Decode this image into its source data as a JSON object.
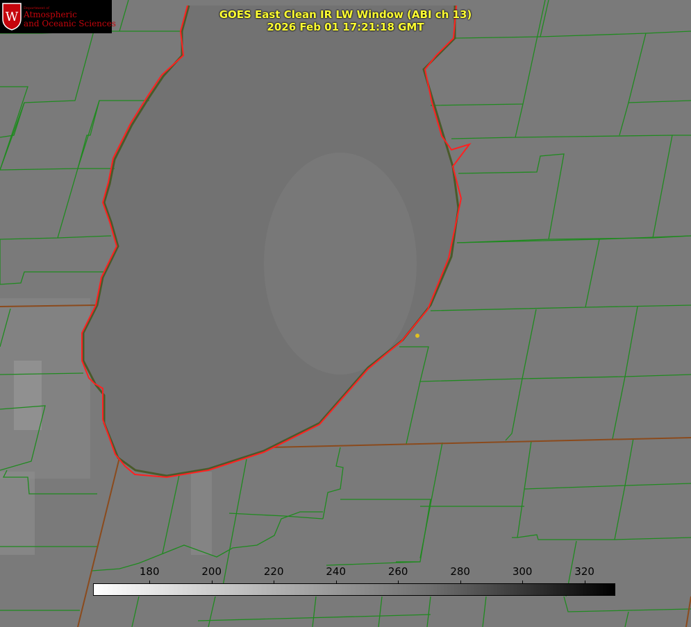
{
  "logo": {
    "department": "Department of",
    "line1": "Atmospheric",
    "line2": "and Oceanic Sciences",
    "crest_letter": "W",
    "brand_color": "#c5050c"
  },
  "title": {
    "line1": "GOES East Clean IR LW Window (ABI ch 13)",
    "line2": "2026 Feb 01 17:21:18 GMT",
    "color": "#ffff33"
  },
  "colorbar": {
    "ticks": [
      {
        "value": "180",
        "pos": 0.108
      },
      {
        "value": "200",
        "pos": 0.227
      },
      {
        "value": "220",
        "pos": 0.346
      },
      {
        "value": "240",
        "pos": 0.465
      },
      {
        "value": "260",
        "pos": 0.584
      },
      {
        "value": "280",
        "pos": 0.703
      },
      {
        "value": "300",
        "pos": 0.822
      },
      {
        "value": "320",
        "pos": 0.941
      }
    ],
    "gradient": [
      "#ffffff",
      "#000000"
    ]
  },
  "map_colors": {
    "county_lines": "#1f8a1f",
    "state_lines": "#8b4a1c",
    "lake_shore": "#ff2020",
    "marker": "#e0c020"
  }
}
